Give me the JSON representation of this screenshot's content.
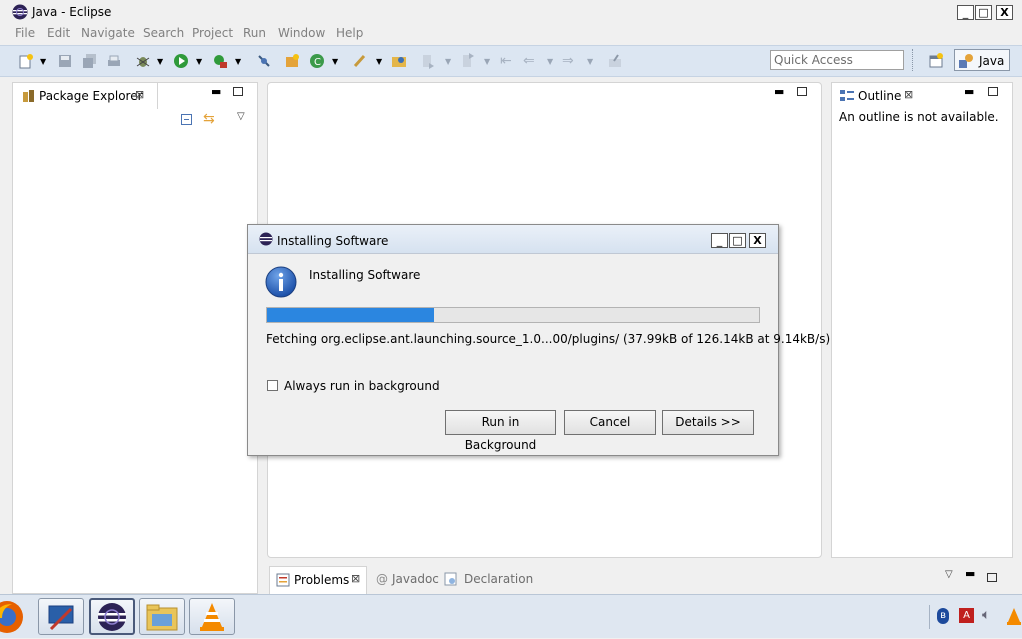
{
  "window": {
    "title": "Java - Eclipse",
    "min": "_",
    "max": "□",
    "close": "X"
  },
  "menu": [
    "File",
    "Edit",
    "Navigate",
    "Search",
    "Project",
    "Run",
    "Window",
    "Help"
  ],
  "toolbar": {
    "quick_access_placeholder": "Quick Access",
    "perspective_label": "Java"
  },
  "package_explorer": {
    "title": "Package Explorer",
    "close": "⊠"
  },
  "outline": {
    "title": "Outline",
    "close": "⊠",
    "message": "An outline is not available."
  },
  "bottom_tabs": {
    "problems": "Problems",
    "javadoc": "Javadoc",
    "declaration": "Declaration",
    "close": "⊠",
    "javadoc_prefix": "@"
  },
  "dialog": {
    "title": "Installing Software",
    "heading": "Installing Software",
    "progress": 0.34,
    "status": "Fetching org.eclipse.ant.launching.source_1.0...00/plugins/ (37.99kB of 126.14kB at 9.14kB/s)",
    "checkbox_label": "Always run in background",
    "checkbox_checked": false,
    "buttons": {
      "run_background": "Run in Background",
      "cancel": "Cancel",
      "details": "Details >>"
    },
    "min": "_",
    "max": "□",
    "close": "X"
  },
  "colors": {
    "progress": "#2b86e0",
    "toolbar": "#dce6f2",
    "eclipse_purple": "#3b2a7a"
  }
}
